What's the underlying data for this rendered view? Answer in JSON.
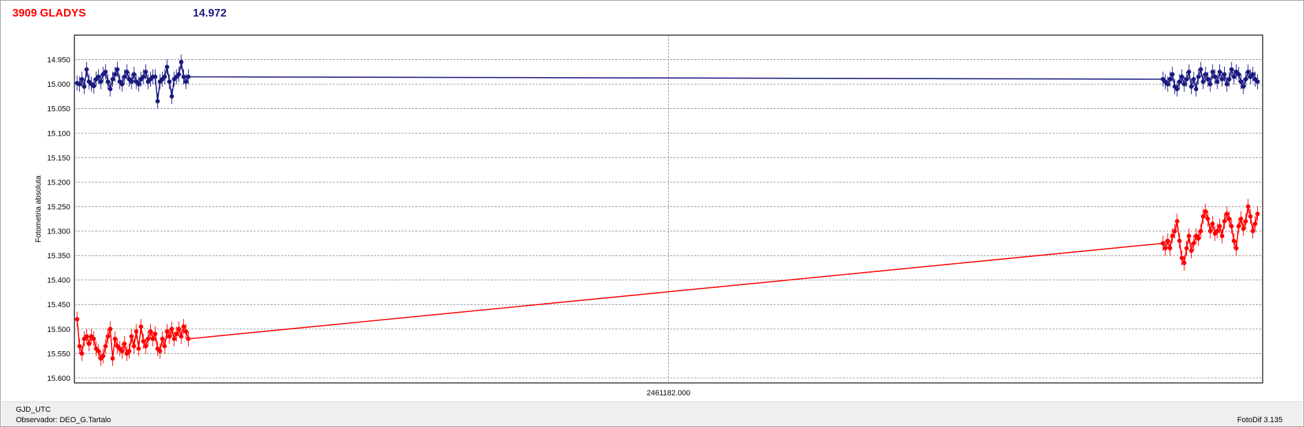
{
  "header": {
    "object_name": "3909 GLADYS",
    "comparison_magnitude": "14.972"
  },
  "footer": {
    "x_axis_name": "GJD_UTC",
    "observer_label": "Observador: DEO_G.Tartalo",
    "software_version": "FotoDif 3.135"
  },
  "colors": {
    "target_series": "#ff0000",
    "comparison_series": "#1a1a80",
    "grid": "#808080"
  },
  "chart_data": {
    "type": "scatter",
    "title": "",
    "xlabel": "",
    "ylabel": "Fotometria absoluta",
    "y_inverted": true,
    "ylim": [
      15.61,
      14.9
    ],
    "yticks": [
      "14.950",
      "15.000",
      "15.050",
      "15.100",
      "15.150",
      "15.200",
      "15.250",
      "15.300",
      "15.350",
      "15.400",
      "15.450",
      "15.500",
      "15.550",
      "15.600"
    ],
    "xtick_label": "2461182.000",
    "grid": true,
    "series": [
      {
        "color": "#1a1a80",
        "segments": [
          {
            "x": [
              0.0,
              0.002,
              0.004,
              0.006,
              0.008,
              0.01,
              0.012,
              0.014,
              0.016,
              0.018,
              0.02,
              0.022,
              0.024,
              0.026,
              0.028,
              0.03,
              0.032,
              0.034,
              0.036,
              0.038,
              0.04,
              0.042,
              0.044,
              0.046,
              0.048,
              0.05,
              0.052,
              0.054,
              0.056,
              0.058,
              0.06,
              0.062,
              0.064,
              0.066,
              0.068,
              0.07,
              0.072,
              0.074,
              0.076,
              0.078,
              0.08,
              0.082,
              0.084,
              0.086,
              0.088,
              0.09,
              0.092,
              0.094
            ],
            "values": [
              14.998,
              15.0,
              14.99,
              15.005,
              14.97,
              14.995,
              15.0,
              15.004,
              14.99,
              14.985,
              14.995,
              14.98,
              14.975,
              14.995,
              15.01,
              14.99,
              14.98,
              14.97,
              14.995,
              15.0,
              14.985,
              14.975,
              14.99,
              14.995,
              14.98,
              14.995,
              15.0,
              14.99,
              14.985,
              14.975,
              14.995,
              14.99,
              14.985,
              14.985,
              15.035,
              14.995,
              14.99,
              14.985,
              14.965,
              14.995,
              15.025,
              14.99,
              14.985,
              14.98,
              14.955,
              14.985,
              14.995,
              14.985
            ]
          },
          {
            "x": [
              0.918,
              0.92,
              0.922,
              0.924,
              0.926,
              0.928,
              0.93,
              0.932,
              0.934,
              0.936,
              0.938,
              0.94,
              0.942,
              0.944,
              0.946,
              0.948,
              0.95,
              0.952,
              0.954,
              0.956,
              0.958,
              0.96,
              0.962,
              0.964,
              0.966,
              0.968,
              0.97,
              0.972,
              0.974,
              0.976,
              0.978,
              0.98,
              0.982,
              0.984,
              0.986,
              0.988,
              0.99,
              0.992,
              0.994,
              0.996,
              0.998
            ],
            "values": [
              14.99,
              14.995,
              15.0,
              14.99,
              14.98,
              15.005,
              15.01,
              14.995,
              14.985,
              15.0,
              14.99,
              14.975,
              15.005,
              14.99,
              15.01,
              14.985,
              14.97,
              14.995,
              14.98,
              14.99,
              15.0,
              14.975,
              14.985,
              14.995,
              14.975,
              14.99,
              14.98,
              15.0,
              14.99,
              14.97,
              14.985,
              14.975,
              14.98,
              14.995,
              15.005,
              14.99,
              14.975,
              14.985,
              14.98,
              14.99,
              14.995
            ]
          }
        ]
      },
      {
        "color": "#ff0000",
        "segments": [
          {
            "x": [
              0.0,
              0.002,
              0.004,
              0.006,
              0.008,
              0.01,
              0.012,
              0.014,
              0.016,
              0.018,
              0.02,
              0.022,
              0.024,
              0.026,
              0.028,
              0.03,
              0.032,
              0.034,
              0.036,
              0.038,
              0.04,
              0.042,
              0.044,
              0.046,
              0.048,
              0.05,
              0.052,
              0.054,
              0.056,
              0.058,
              0.06,
              0.062,
              0.064,
              0.066,
              0.068,
              0.07,
              0.072,
              0.074,
              0.076,
              0.078,
              0.08,
              0.082,
              0.084,
              0.086,
              0.088,
              0.09,
              0.092,
              0.094
            ],
            "values": [
              15.48,
              15.535,
              15.55,
              15.52,
              15.515,
              15.53,
              15.515,
              15.52,
              15.54,
              15.545,
              15.56,
              15.555,
              15.535,
              15.515,
              15.5,
              15.56,
              15.52,
              15.535,
              15.54,
              15.545,
              15.53,
              15.55,
              15.545,
              15.515,
              15.535,
              15.505,
              15.54,
              15.495,
              15.525,
              15.535,
              15.52,
              15.505,
              15.52,
              15.51,
              15.54,
              15.545,
              15.52,
              15.535,
              15.505,
              15.515,
              15.5,
              15.52,
              15.51,
              15.5,
              15.515,
              15.495,
              15.505,
              15.52
            ]
          },
          {
            "x": [
              0.918,
              0.92,
              0.922,
              0.924,
              0.926,
              0.928,
              0.93,
              0.932,
              0.934,
              0.936,
              0.938,
              0.94,
              0.942,
              0.944,
              0.946,
              0.948,
              0.95,
              0.952,
              0.954,
              0.956,
              0.958,
              0.96,
              0.962,
              0.964,
              0.966,
              0.968,
              0.97,
              0.972,
              0.974,
              0.976,
              0.978,
              0.98,
              0.982,
              0.984,
              0.986,
              0.988,
              0.99,
              0.992,
              0.994,
              0.996,
              0.998
            ],
            "values": [
              15.325,
              15.335,
              15.32,
              15.335,
              15.31,
              15.3,
              15.28,
              15.32,
              15.355,
              15.365,
              15.335,
              15.31,
              15.34,
              15.325,
              15.31,
              15.315,
              15.3,
              15.27,
              15.26,
              15.275,
              15.3,
              15.285,
              15.305,
              15.3,
              15.29,
              15.31,
              15.28,
              15.265,
              15.275,
              15.29,
              15.32,
              15.335,
              15.29,
              15.275,
              15.295,
              15.28,
              15.25,
              15.27,
              15.3,
              15.285,
              15.265
            ]
          }
        ]
      }
    ]
  }
}
